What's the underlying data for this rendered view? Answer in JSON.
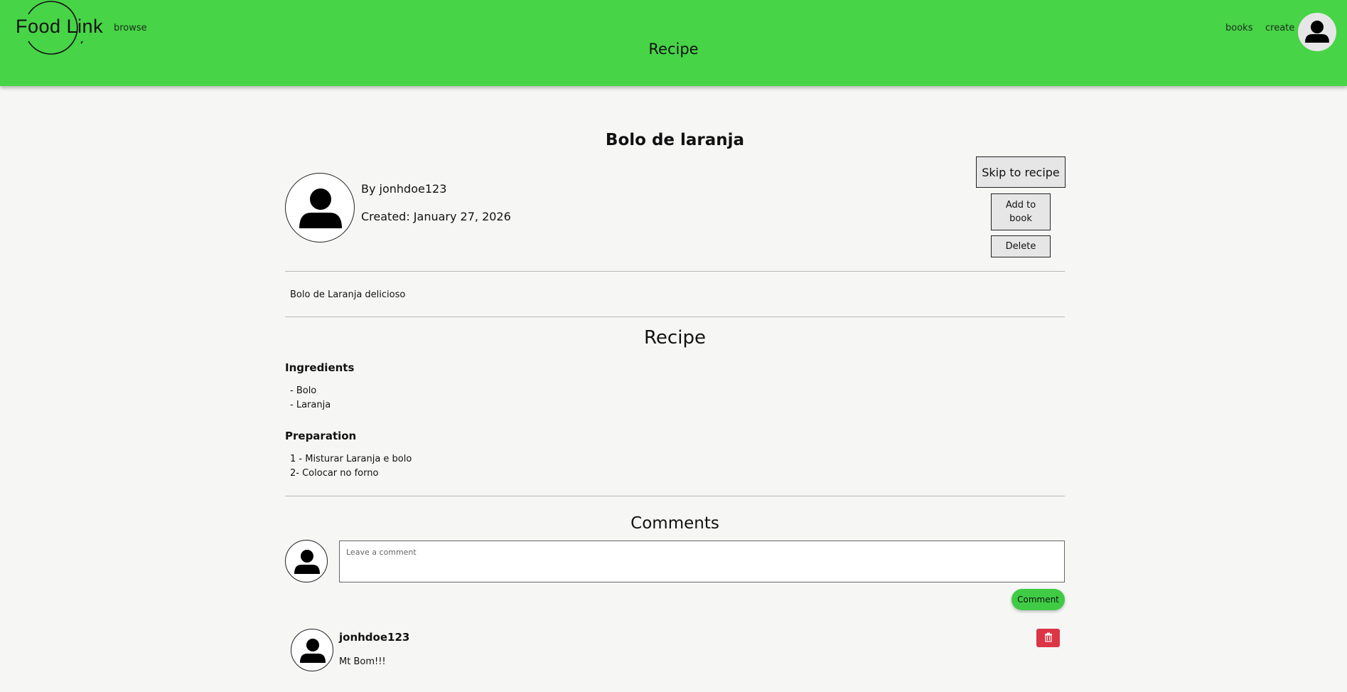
{
  "header": {
    "logo_text": "Food Link",
    "nav_left": {
      "browse_label": "browse"
    },
    "nav_right": {
      "books_label": "books",
      "create_label": "create"
    },
    "page_title": "Recipe",
    "avatar_icon": "user-avatar-icon",
    "background_color": "#47d447"
  },
  "recipe": {
    "title": "Bolo de laranja",
    "author_line": "By jonhdoe123",
    "created_line": "Created: January 27, 2026",
    "description": "Bolo de Laranja delicioso",
    "actions": {
      "skip_label": "Skip to recipe",
      "add_to_book_label": "Add to book",
      "delete_label": "Delete"
    },
    "section_title": "Recipe",
    "ingredients_heading": "Ingredients",
    "ingredients": [
      "- Bolo",
      "- Laranja"
    ],
    "preparation_heading": "Preparation",
    "preparation": [
      "1 - Misturar Laranja e bolo",
      "2- Colocar no forno"
    ]
  },
  "comments": {
    "section_title": "Comments",
    "input_placeholder": "Leave a comment",
    "input_value": "",
    "submit_label": "Comment",
    "submit_color": "#3fcc44",
    "items": [
      {
        "author": "jonhdoe123",
        "text": "Mt Bom!!!",
        "delete_icon": "trash-icon",
        "delete_color": "#dc3545"
      }
    ]
  }
}
